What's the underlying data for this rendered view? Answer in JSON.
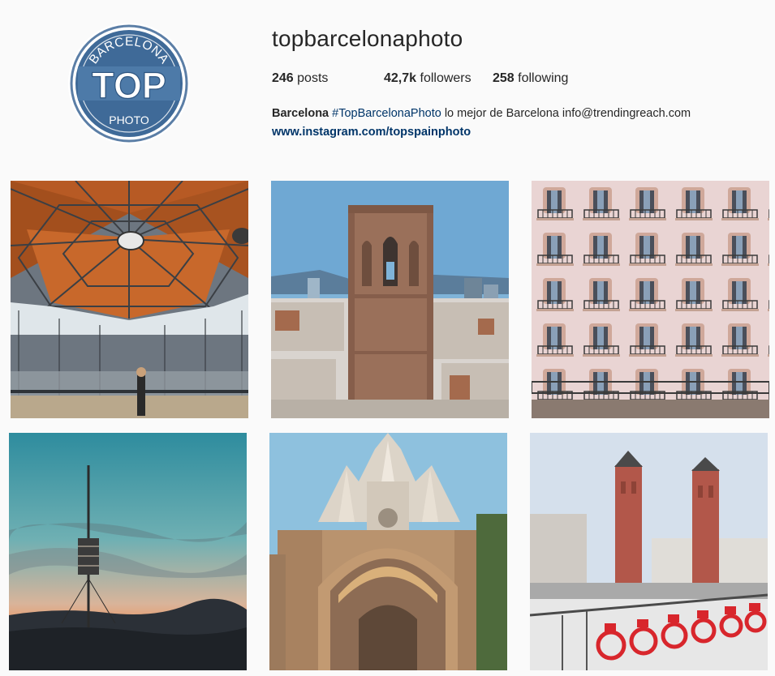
{
  "profile": {
    "avatar": {
      "ring_top": "BARCELONA",
      "center": "TOP",
      "ring_bottom": "PHOTO"
    },
    "username": "topbarcelonaphoto",
    "stats": {
      "posts": {
        "count": "246",
        "label": "posts"
      },
      "followers": {
        "count": "42,7k",
        "label": "followers"
      },
      "following": {
        "count": "258",
        "label": "following"
      }
    },
    "bio": {
      "name": "Barcelona",
      "hashtag": "#TopBarcelonaPhoto",
      "text": " lo mejor de Barcelona info@trendingreach.com",
      "website": "www.instagram.com/topspainphoto"
    }
  },
  "posts": [
    {
      "subject": "market-octagonal-roof"
    },
    {
      "subject": "gothic-bell-tower"
    },
    {
      "subject": "ornate-balcony-facade"
    },
    {
      "subject": "collserola-tower-sunset"
    },
    {
      "subject": "tibidabo-temple"
    },
    {
      "subject": "venetian-towers-bicing"
    }
  ],
  "colors": {
    "brand_blue": "#3d6896",
    "link": "#003569",
    "text": "#262626",
    "background": "#fafafa"
  }
}
